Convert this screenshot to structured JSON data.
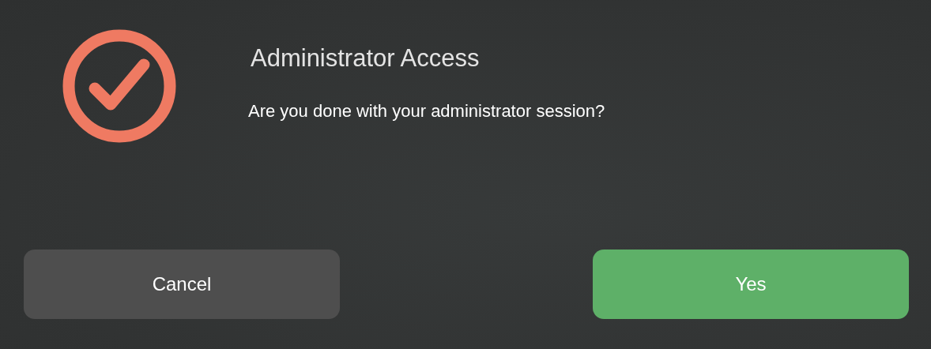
{
  "dialog": {
    "title": "Administrator Access",
    "message": "Are you done with your administrator session?"
  },
  "buttons": [
    {
      "label": "Cancel",
      "kind": "secondary"
    },
    {
      "label": "Yes",
      "kind": "primary"
    }
  ]
}
